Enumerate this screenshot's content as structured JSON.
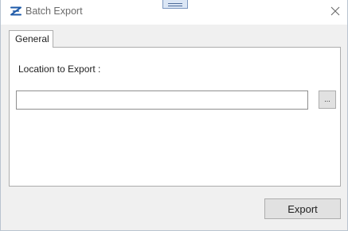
{
  "window": {
    "title": "Batch Export",
    "app_icon": "batch-export-app-icon",
    "close_icon": "close-icon"
  },
  "tabs": [
    {
      "label": "General",
      "selected": true
    }
  ],
  "general": {
    "location_label": "Location to Export :",
    "location_value": "",
    "browse_label": "..."
  },
  "footer": {
    "export_label": "Export"
  },
  "colors": {
    "window_bg": "#f0f0f0",
    "panel_bg": "#ffffff",
    "button_bg": "#e1e1e1",
    "border": "#adadad",
    "title_text": "#6a6a6a",
    "app_icon_blue": "#1e5aa8",
    "drag_handle_bg": "#dbe6f5"
  }
}
